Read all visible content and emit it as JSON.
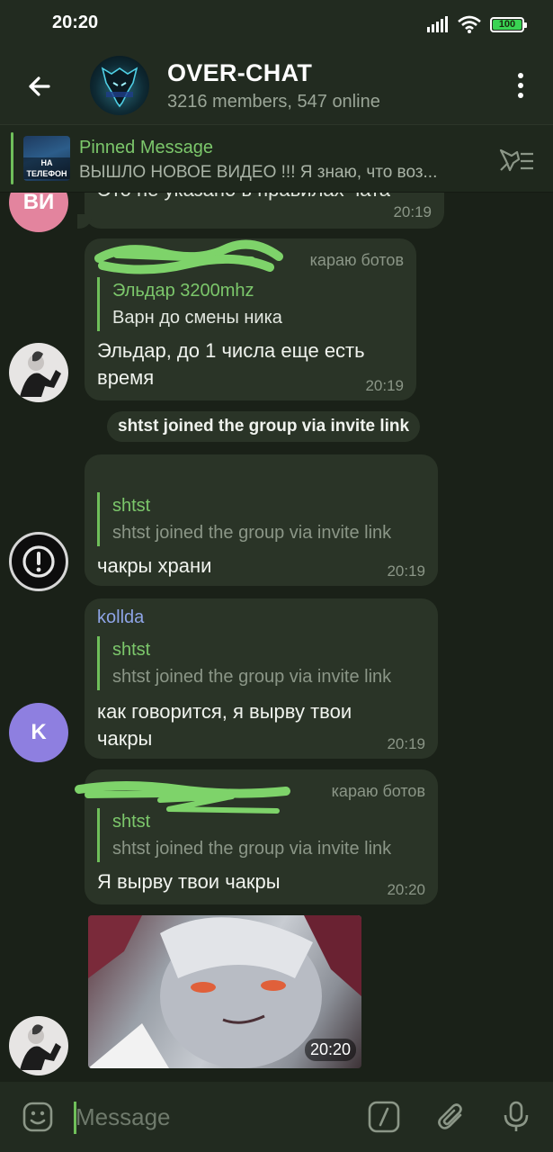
{
  "status_bar": {
    "time": "20:20",
    "battery": "100",
    "icons": [
      "signal-icon",
      "wifi-icon",
      "battery-icon"
    ]
  },
  "header": {
    "title": "OVER-CHAT",
    "subtitle": "3216 members, 547 online",
    "icons": [
      "back-arrow-icon",
      "more-vertical-icon"
    ]
  },
  "pinned": {
    "title": "Pinned Message",
    "text": "ВЫШЛО НОВОЕ ВИДЕО !!! Я знаю, что воз...",
    "thumb_text": "НА ТЕЛЕФОН",
    "icon": "unpin-icon"
  },
  "messages": [
    {
      "avatar_initials": "ВИ",
      "partial_text": "Это не указано в правилах чата",
      "time": "20:19"
    },
    {
      "admin_tag": "караю ботов",
      "reply_name": "Эльдар 3200mhz",
      "reply_text": "Варн до смены ника",
      "text_line1": "Эльдар, до 1 числа еще есть",
      "text_line2": "время",
      "time": "20:19"
    },
    {
      "service": "shtst joined the group via invite link"
    },
    {
      "reply_name": "shtst",
      "reply_text": "shtst joined the group via invite link",
      "text": "чакры храни",
      "time": "20:19"
    },
    {
      "sender": "kollda",
      "reply_name": "shtst",
      "reply_text": "shtst joined the group via invite link",
      "text_line1": "как говорится, я вырву твои",
      "text_line2": "чакры",
      "time": "20:19",
      "avatar_initials": "K"
    },
    {
      "admin_tag": "караю ботов",
      "reply_name": "shtst",
      "reply_text": "shtst joined the group via invite link",
      "text": "Я вырву твои чакры",
      "time": "20:20"
    },
    {
      "photo_time": "20:20"
    }
  ],
  "input": {
    "placeholder": "Message",
    "icons": [
      "emoji-icon",
      "bot-command-icon",
      "attach-icon",
      "mic-icon"
    ]
  },
  "colors": {
    "background": "#1a2118",
    "bubble": "#2a3427",
    "accent": "#6fbf5a",
    "sender_kollda": "#8ea4e6",
    "avatar_vi": "#e3849e",
    "avatar_k": "#8e7fe0"
  }
}
